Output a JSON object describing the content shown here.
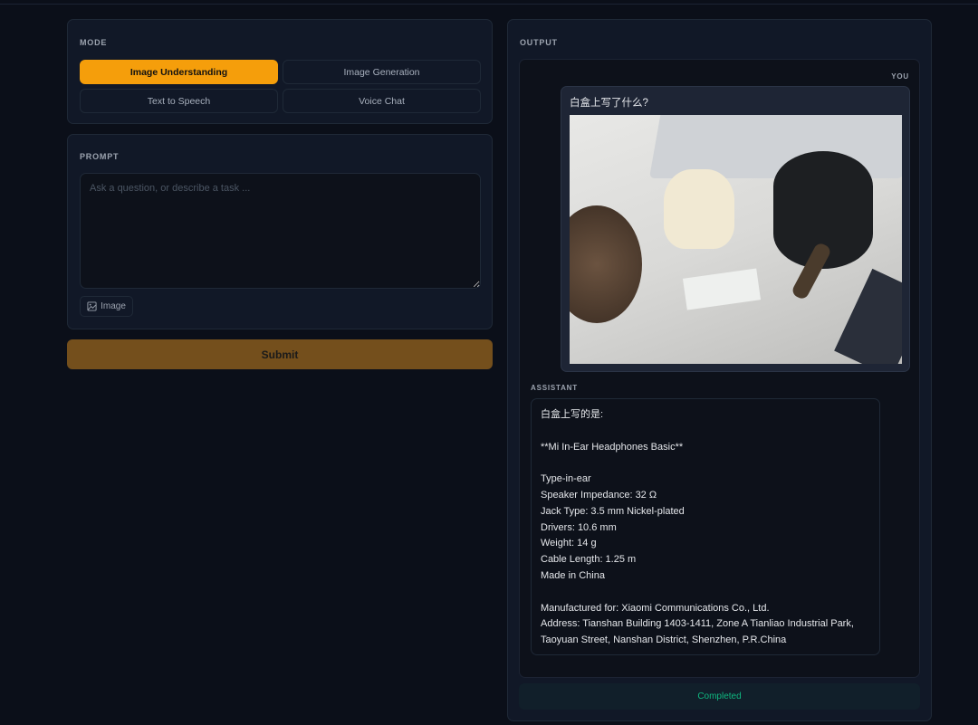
{
  "mode": {
    "label": "MODE",
    "options": [
      "Image Understanding",
      "Image Generation",
      "Text to Speech",
      "Voice Chat"
    ],
    "selected": "Image Understanding"
  },
  "prompt": {
    "label": "PROMPT",
    "placeholder": "Ask a question, or describe a task ...",
    "value": "",
    "image_button": "Image"
  },
  "submit_label": "Submit",
  "output": {
    "label": "OUTPUT",
    "user_label": "YOU",
    "user_message": "白盒上写了什么?",
    "assistant_label": "ASSISTANT",
    "assistant_lines": [
      "白盒上写的是:",
      "",
      "**Mi In-Ear Headphones Basic**",
      "",
      "Type-in-ear",
      "Speaker Impedance: 32 Ω",
      "Jack Type: 3.5 mm Nickel-plated",
      "Drivers: 10.6 mm",
      "Weight: 14 g",
      "Cable Length: 1.25 m",
      "Made in China",
      "",
      "Manufactured for: Xiaomi Communications Co., Ltd.",
      "Address: Tianshan Building 1403-1411, Zone A Tianliao Industrial Park,",
      "Taoyuan Street, Nanshan District, Shenzhen, P.R.China"
    ],
    "status": "Completed"
  },
  "colors": {
    "accent": "#f59e0b",
    "success": "#10b981"
  }
}
